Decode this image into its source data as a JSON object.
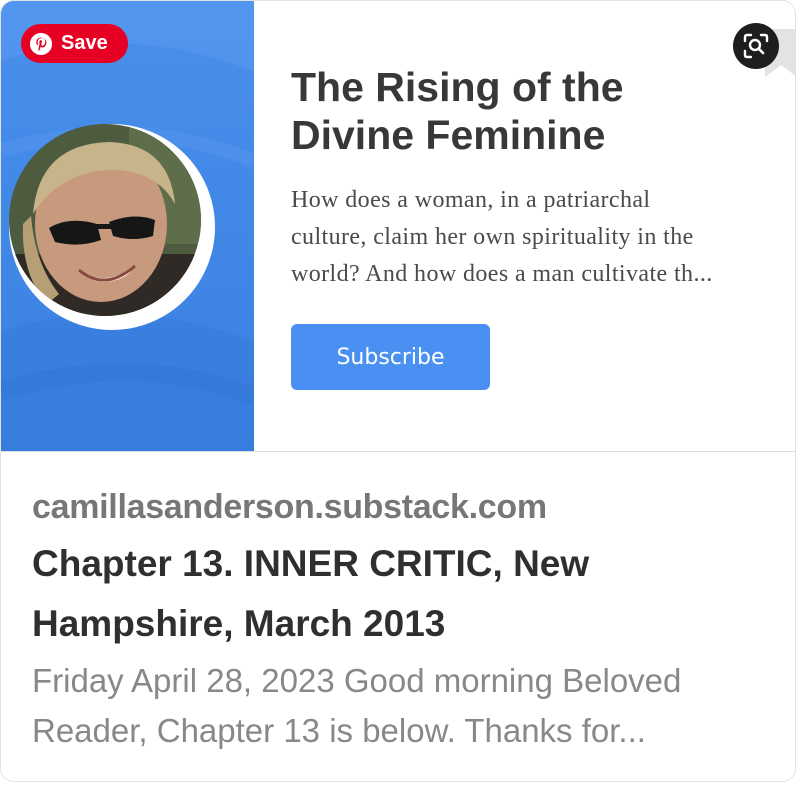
{
  "pin": {
    "save_label": "Save",
    "save_icon": "pinterest-icon",
    "lens_icon": "visual-search-icon"
  },
  "hero": {
    "title_line1": "The Rising of the",
    "title_line2": "Divine Feminine",
    "description_lines": [
      "How does a woman, in a patriarchal",
      "culture, claim her own spirituality in the",
      "world? And how does a man cultivate th..."
    ],
    "subscribe_label": "Subscribe",
    "accent_color": "#4a90f2",
    "panel_color": "#3f86e6",
    "avatar": "author-photo"
  },
  "link": {
    "domain": "camillasanderson.substack.com",
    "headline_lines": [
      "Chapter 13. INNER CRITIC, New",
      "Hampshire, March 2013"
    ],
    "snippet_lines": [
      "Friday April 28, 2023 Good morning Beloved",
      "Reader, Chapter 13 is below. Thanks for..."
    ]
  }
}
